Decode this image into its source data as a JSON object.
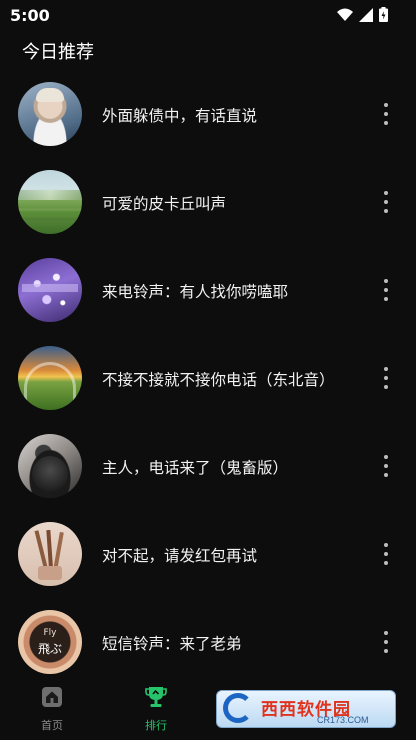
{
  "status": {
    "time": "5:00"
  },
  "section_title": "今日推荐",
  "items": [
    {
      "title": "外面躲债中，有话直说"
    },
    {
      "title": "可爱的皮卡丘叫声"
    },
    {
      "title": "来电铃声：有人找你唠嗑耶"
    },
    {
      "title": "不接不接就不接你电话（东北音）"
    },
    {
      "title": "主人，电话来了（鬼畜版）"
    },
    {
      "title": "对不起，请发红包再试"
    },
    {
      "title": "短信铃声：来了老弟"
    }
  ],
  "nav": {
    "home_label": "首页",
    "rank_label": "排行",
    "active_color": "#27c46b",
    "inactive_color": "#8a8a8a"
  },
  "watermark": {
    "text": "西西软件园",
    "url": "CR173.COM"
  },
  "avatar_text": {
    "line1": "Fly",
    "line2": "飛ぶ"
  }
}
